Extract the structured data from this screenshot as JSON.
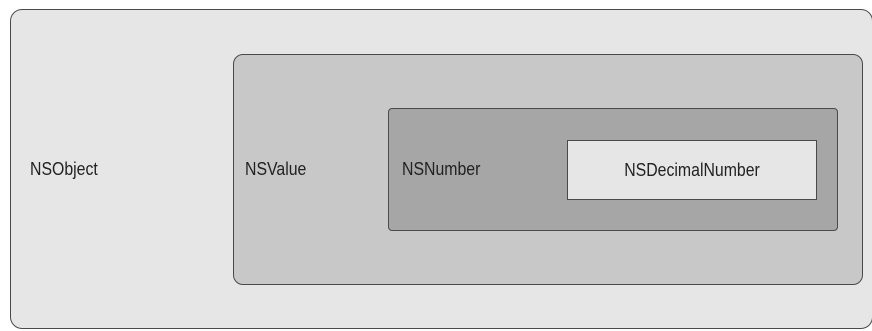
{
  "diagram": {
    "nested_classes": [
      {
        "label": "NSObject",
        "fill": "#e6e6e6"
      },
      {
        "label": "NSValue",
        "fill": "#c8c8c8"
      },
      {
        "label": "NSNumber",
        "fill": "#a6a6a6"
      },
      {
        "label": "NSDecimalNumber",
        "fill": "#e6e6e6"
      }
    ]
  }
}
